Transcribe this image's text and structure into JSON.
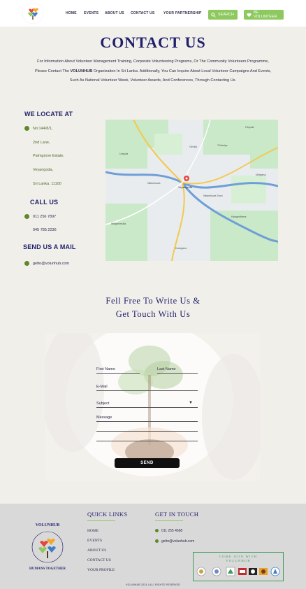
{
  "header": {
    "logo_text_top": "VOLUNHUB",
    "logo_text_bottom": "HUMANS TOGETHER",
    "nav": [
      "HOME",
      "EVENTS",
      "ABOUT US",
      "CONTACT US",
      "YOUR PARTNERSHIP"
    ],
    "search_label": "SEARCH",
    "volunteer_label": "BE VOLUNTEER"
  },
  "contact": {
    "title": "CONTACT  US",
    "intro_pre": "For Information About Volunteer Management Training, Corporate Volunteering Programs, Or The Community Volunteers Programme, Please Contact The ",
    "intro_brand": "VOLUNHUB",
    "intro_post": " Organization In Sri Lanka.  Additionally, You Can Inquire About Local Volunteer Campaigns And Events, Such As National Volunteer Week, Volunteer Awards, And Conferences, Through Contacting Us.",
    "locate_heading": "WE LOCATE AT",
    "address": [
      "No:144/8/1,",
      "2nd Lane,",
      "Palmgrove Estate,",
      "Veyangoda,",
      "Sri Lanka. 11100"
    ],
    "call_heading": "CALL US",
    "phones": [
      "011 256 7897",
      "045 785 2236"
    ],
    "mail_heading": "SEND US A MAIL",
    "email": "getto@volunhub.com"
  },
  "map": {
    "labels": [
      "Veyangoda",
      "Nittambuwa",
      "Thihariya",
      "Urapola",
      "Pasyala",
      "Walgammulla",
      "Mirigama",
      "Kalagedihena",
      "Nittambuwa Town",
      "Giriulla",
      "Dunagaha"
    ]
  },
  "write_us": {
    "line1": "Fell  Free  To  Write  Us  &",
    "line2": "Get  Touch  With  Us"
  },
  "form": {
    "first_name": "First Name",
    "last_name": "Last Name",
    "email": "E-Mail",
    "subject": "Subject",
    "message": "Message",
    "send": "SEND"
  },
  "footer": {
    "quick_links_heading": "QUICK LINKS",
    "quick_links": [
      "HOME",
      "EVENTS",
      "ABOUT US",
      "CONTACT US",
      "YOUR PROFILE"
    ],
    "get_in_touch_heading": "GET IN TOUCH",
    "phone": "011 255 4568",
    "email": "getto@volunhub.com",
    "join_line1": "COME  JOIN  WITH",
    "join_line2": "VOLUNHUB",
    "copyright": "VOLUNHUB 2024  |  ALL RIGHTS RESERVED"
  },
  "colors": {
    "primary": "#1f1f6b",
    "accent_green": "#8dc95f",
    "dark_green": "#5b8a2a",
    "background": "#f1efea",
    "footer_bg": "#d9d9d9"
  }
}
